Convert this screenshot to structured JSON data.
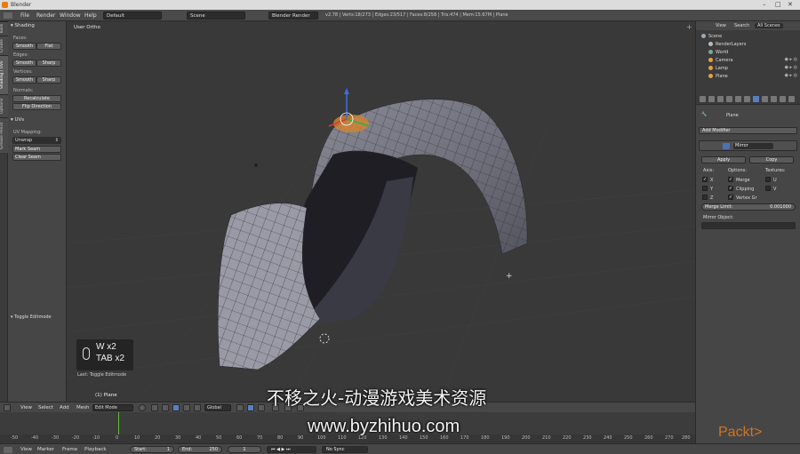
{
  "window": {
    "title": "Blender"
  },
  "info_header": {
    "menus": [
      "File",
      "Render",
      "Window",
      "Help"
    ],
    "layout": "Default",
    "scene": "Scene",
    "render_engine": "Blender Render",
    "stats": "v2.78 | Verts:18/273 | Edges:23/517 | Faces:8/258 | Tris:474 | Mem:15.67M | Plane"
  },
  "tool_tabs": [
    "Tools",
    "Create",
    "Shading / UVs",
    "Options",
    "Grease Pencil"
  ],
  "toolshelf": {
    "shading_header": "Shading",
    "faces_label": "Faces:",
    "edges_label": "Edges:",
    "vertices_label": "Vertices:",
    "normals_label": "Normals:",
    "smooth": "Smooth",
    "flat": "Flat",
    "sharp": "Sharp",
    "recalculate": "Recalculate",
    "flip_direction": "Flip Direction",
    "uvs_header": "UVs",
    "uv_mapping_label": "UV Mapping:",
    "unwrap": "Unwrap",
    "mark_seam": "Mark Seam",
    "clear_seam": "Clear Seam",
    "operator_header": "Toggle Editmode"
  },
  "viewport": {
    "view_label": "User Ortho",
    "object_label": "(1) Plane",
    "last_op": "Last: Toggle Editmode",
    "keys_line1": "W x2",
    "keys_line2": "TAB x2"
  },
  "view_header": {
    "menus": [
      "View",
      "Select",
      "Add",
      "Mesh"
    ],
    "mode": "Edit Mode",
    "orientation": "Global"
  },
  "timeline": {
    "ticks": [
      "-50",
      "-40",
      "-30",
      "-20",
      "-10",
      "0",
      "10",
      "20",
      "30",
      "40",
      "50",
      "60",
      "70",
      "80",
      "90",
      "100",
      "110",
      "120",
      "130",
      "140",
      "150",
      "160",
      "170",
      "180",
      "190",
      "200",
      "210",
      "220",
      "230",
      "240",
      "250",
      "260",
      "270",
      "280"
    ],
    "menus": [
      "View",
      "Marker",
      "Frame",
      "Playback"
    ],
    "start": "Start:",
    "start_val": "1",
    "end": "End:",
    "end_val": "250",
    "current": "1",
    "sync": "No Sync"
  },
  "outliner": {
    "tabs": [
      "View",
      "Search",
      "All Scenes"
    ],
    "rows": [
      "Scene",
      "RenderLayers",
      "World",
      "Camera",
      "Lamp",
      "Plane"
    ]
  },
  "properties": {
    "object_name": "Plane",
    "add_modifier": "Add Modifier",
    "modifier_name": "Mirror",
    "apply": "Apply",
    "copy": "Copy",
    "axis_label": "Axis:",
    "options_label": "Options:",
    "textures_label": "Textures:",
    "axes": [
      "X",
      "Y",
      "Z"
    ],
    "options": [
      "Merge",
      "Clipping",
      "Vertex Gr"
    ],
    "textures": [
      "U",
      "V"
    ],
    "merge_limit_label": "Merge Limit:",
    "merge_limit_value": "0.001000",
    "mirror_object_label": "Mirror Object:"
  },
  "watermark": {
    "cn": "不移之火-动漫游戏美术资源",
    "url": "www.byzhihuo.com",
    "brand": "Packt>"
  }
}
